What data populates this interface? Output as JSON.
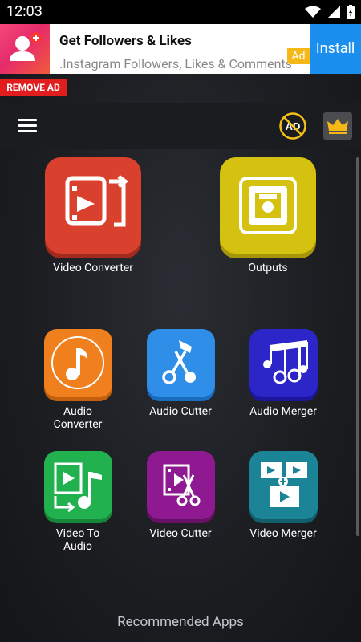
{
  "status_bar": {
    "time": "12:03"
  },
  "ad": {
    "title": "Get Followers & Likes",
    "subtitle": "Instagram Followers, Likes & Comments.",
    "badge": "Ad",
    "install_label": "Install"
  },
  "remove_ad_label": "REMOVE AD",
  "toolbar": {
    "no_ad_label": "AD"
  },
  "tiles": {
    "video_converter": {
      "label": "Video Converter",
      "color": "#d9402e"
    },
    "outputs": {
      "label": "Outputs",
      "color": "#d5c110"
    },
    "audio_converter": {
      "label": "Audio\nConverter",
      "color": "#f07f1e"
    },
    "audio_cutter": {
      "label": "Audio Cutter",
      "color": "#2f8fe8"
    },
    "audio_merger": {
      "label": "Audio Merger",
      "color": "#2c26c9"
    },
    "video_to_audio": {
      "label": "Video To\nAudio",
      "color": "#22b14f"
    },
    "video_cutter": {
      "label": "Video Cutter",
      "color": "#8e1990"
    },
    "video_merger": {
      "label": "Video Merger",
      "color": "#1b8597"
    }
  },
  "recommended_label": "Recommended Apps"
}
